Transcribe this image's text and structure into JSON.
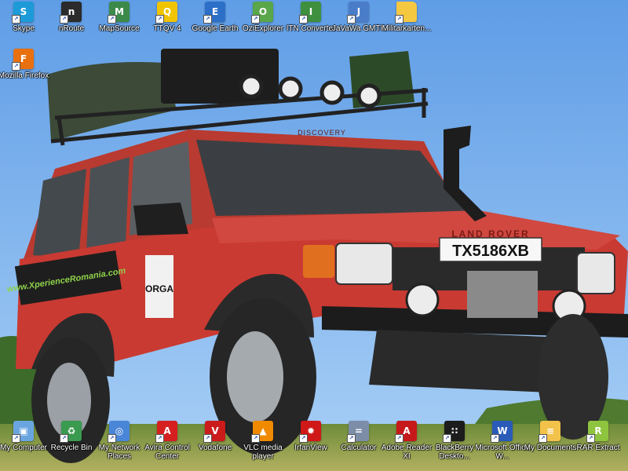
{
  "desktop": {
    "top_icons": [
      {
        "label": "Skype",
        "icon": "skype-icon",
        "color": "#1d9bd8",
        "glyph": "S"
      },
      {
        "label": "nRoute",
        "icon": "nroute-icon",
        "color": "#2b2b2b",
        "glyph": "n"
      },
      {
        "label": "MapSource",
        "icon": "mapsource-icon",
        "color": "#3b8a4a",
        "glyph": "M"
      },
      {
        "label": "TTQV 4",
        "icon": "ttqv-icon",
        "color": "#f0c400",
        "glyph": "Q"
      },
      {
        "label": "Google Earth",
        "icon": "google-earth-icon",
        "color": "#2c6fc7",
        "glyph": "E"
      },
      {
        "label": "OziExplorer",
        "icon": "oziexplorer-icon",
        "color": "#5aa64a",
        "glyph": "O"
      },
      {
        "label": "ITN Converter",
        "icon": "itn-converter-icon",
        "color": "#3e8f3e",
        "glyph": "I"
      },
      {
        "label": "JaVaWa GMTK",
        "icon": "javawa-icon",
        "color": "#4a7dc9",
        "glyph": "J"
      },
      {
        "label": "Militarkarten...",
        "icon": "folder-icon",
        "color": "#f5c842",
        "glyph": ""
      }
    ],
    "left_icons": [
      {
        "label": "Mozilla Firefox",
        "icon": "firefox-icon",
        "color": "#e8700f",
        "glyph": "F"
      }
    ],
    "bottom_icons": [
      {
        "label": "My Computer",
        "icon": "my-computer-icon",
        "color": "#6aa5e0",
        "glyph": "▣"
      },
      {
        "label": "Recycle Bin",
        "icon": "recycle-bin-icon",
        "color": "#3a9a4f",
        "glyph": "♻"
      },
      {
        "label": "My Network Places",
        "icon": "network-places-icon",
        "color": "#4a86d8",
        "glyph": "◎"
      },
      {
        "label": "Avira Control Center",
        "icon": "avira-icon",
        "color": "#d62020",
        "glyph": "A"
      },
      {
        "label": "Vodafone",
        "icon": "vodafone-icon",
        "color": "#cc1b1b",
        "glyph": "V"
      },
      {
        "label": "VLC media player",
        "icon": "vlc-icon",
        "color": "#f08a00",
        "glyph": "▲"
      },
      {
        "label": "IrfanView",
        "icon": "irfanview-icon",
        "color": "#d01818",
        "glyph": "✹"
      },
      {
        "label": "Calculator",
        "icon": "calculator-icon",
        "color": "#7c8da8",
        "glyph": "="
      },
      {
        "label": "Adobe Reader XI",
        "icon": "adobe-reader-icon",
        "color": "#c61a1a",
        "glyph": "A"
      },
      {
        "label": "BlackBerry Deskto...",
        "icon": "blackberry-icon",
        "color": "#1c1c1c",
        "glyph": "∷"
      },
      {
        "label": "Microsoft Office W...",
        "icon": "ms-word-icon",
        "color": "#2a5bb8",
        "glyph": "W"
      },
      {
        "label": "My Documents",
        "icon": "my-documents-icon",
        "color": "#f3c24a",
        "glyph": "≡"
      },
      {
        "label": "RAR Extract",
        "icon": "rar-extract-icon",
        "color": "#8fc43e",
        "glyph": "R"
      }
    ]
  },
  "wallpaper": {
    "plate_text": "TX5186XB",
    "brand_text": "LAND ROVER",
    "hood_text": "DISCOVERY",
    "sticker_text": "ORGA",
    "side_text": "www.XperienceRomania.com",
    "sky_color": "#7fb4ec",
    "body_color": "#c93a32"
  }
}
